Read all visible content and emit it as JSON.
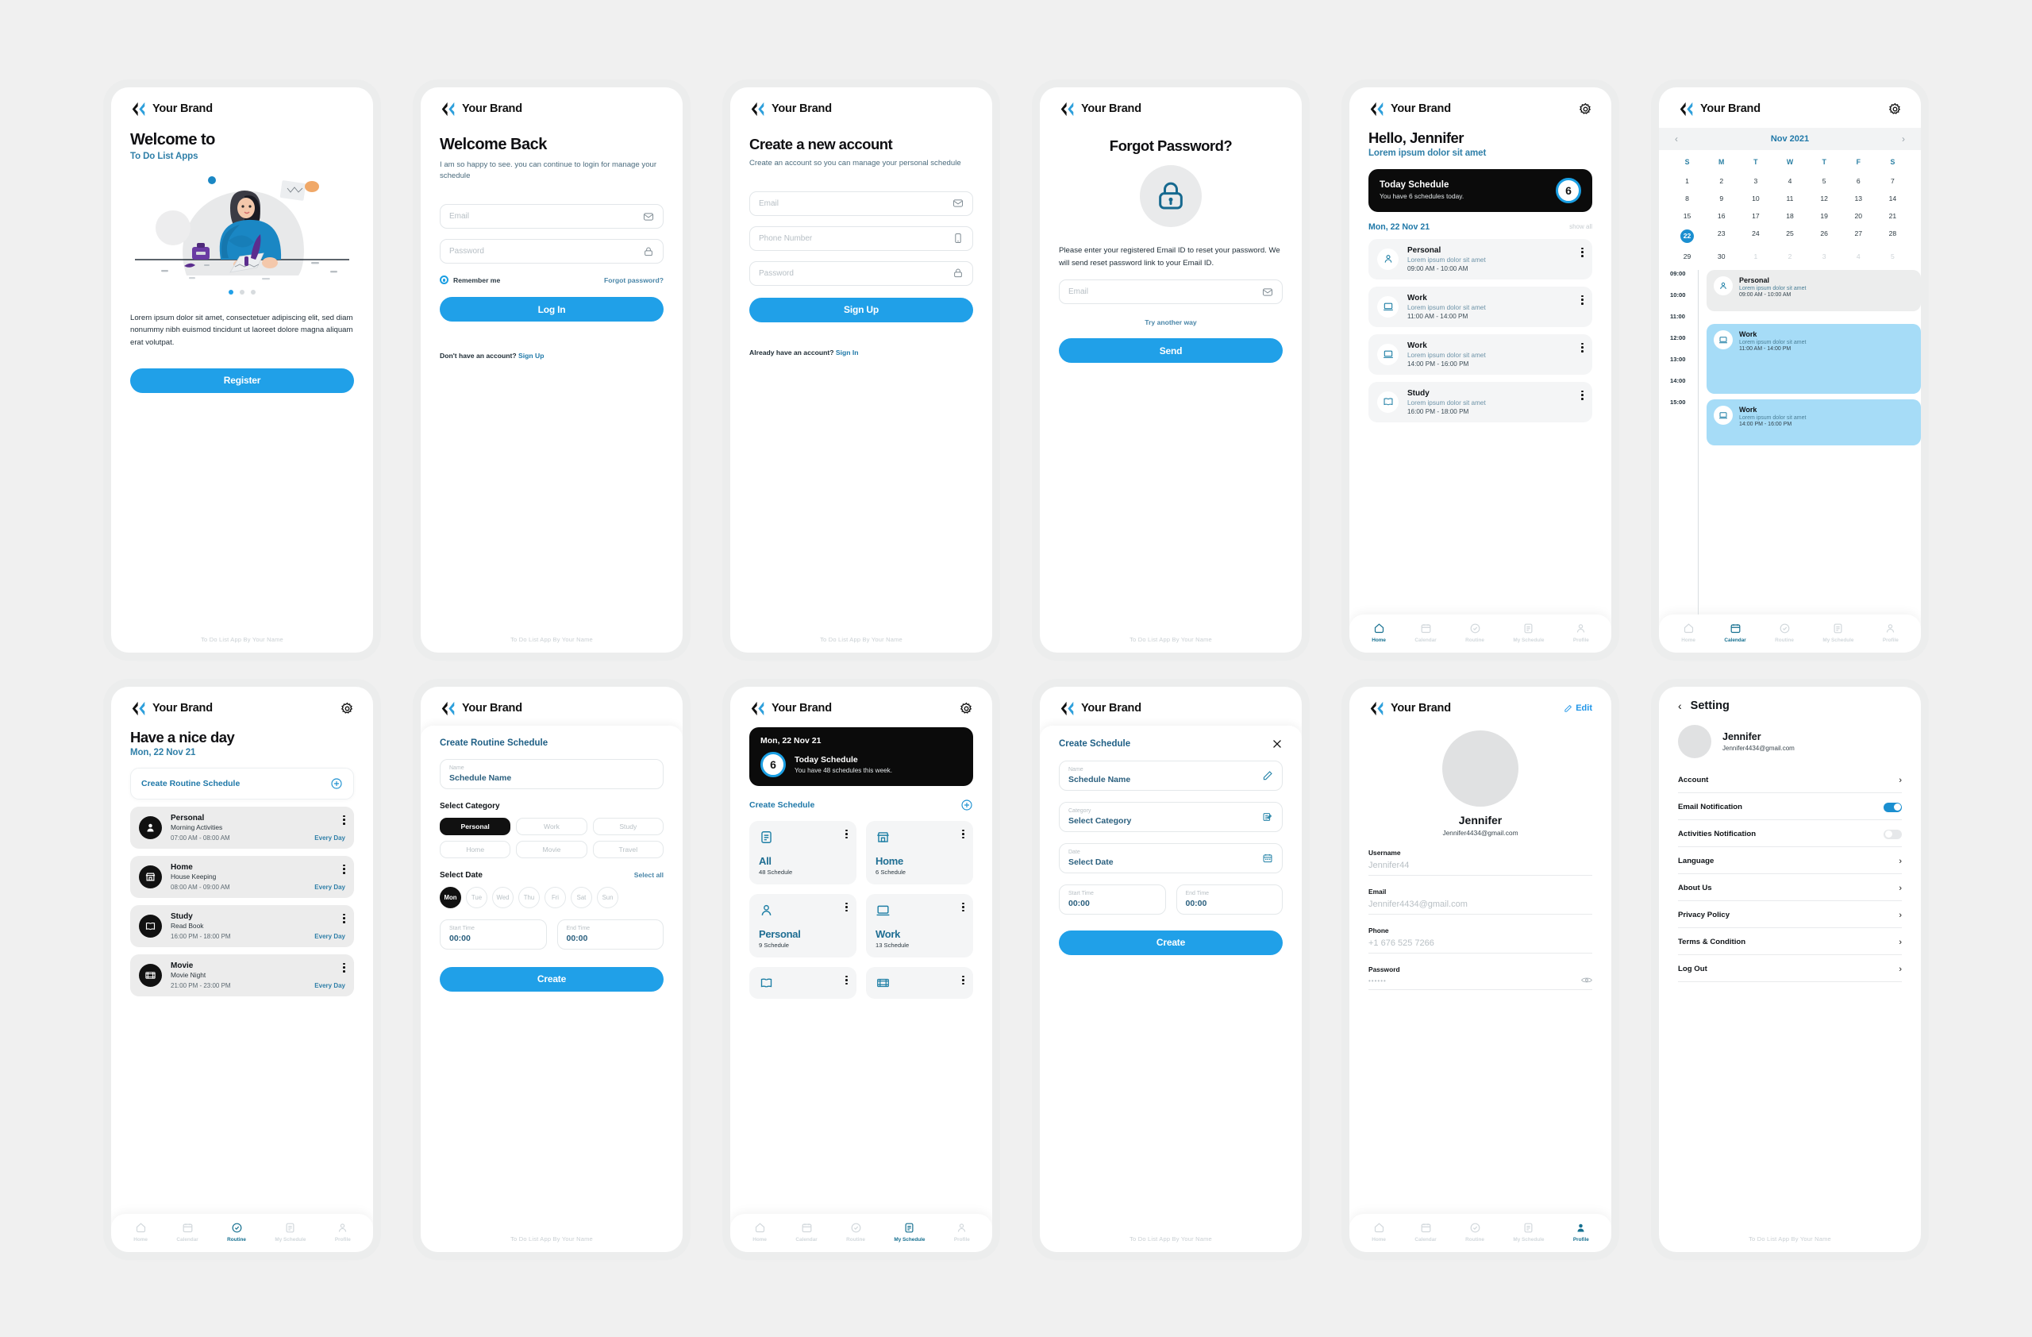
{
  "brand": {
    "name": "Your Brand",
    "footer": "To Do List App By Your Name"
  },
  "colors": {
    "accent": "#20a0e8",
    "dark": "#0b0b0b",
    "teal": "#1f78a8",
    "eventBlue": "#a6dcf7"
  },
  "nav": {
    "items": [
      {
        "label": "Home",
        "icon": "home-icon"
      },
      {
        "label": "Calendar",
        "icon": "calendar-icon"
      },
      {
        "label": "Routine",
        "icon": "check-circle-icon"
      },
      {
        "label": "My Schedule",
        "icon": "list-icon"
      },
      {
        "label": "Profile",
        "icon": "person-icon"
      }
    ]
  },
  "screen1": {
    "title": "Welcome to",
    "subtitle": "To Do List Apps",
    "paragraph": "Lorem ipsum dolor sit amet, consectetuer adipiscing elit, sed diam nonummy nibh euismod tincidunt ut laoreet dolore magna aliquam erat volutpat.",
    "button": "Register",
    "dots": 3,
    "active_dot": 0
  },
  "screen2": {
    "title": "Welcome Back",
    "lead": "I am so happy to see. you can continue to login for manage your schedule",
    "email_placeholder": "Email",
    "password_placeholder": "Password",
    "remember": "Remember me",
    "forgot": "Forgot password?",
    "button": "Log In",
    "account_text": "Don't have an account?",
    "account_link": "Sign Up"
  },
  "screen3": {
    "title": "Create a new account",
    "lead": "Create an account so you can manage your personal schedule",
    "email_placeholder": "Email",
    "phone_placeholder": "Phone Number",
    "password_placeholder": "Password",
    "button": "Sign Up",
    "account_text": "Already have an account?",
    "account_link": "Sign In"
  },
  "screen4": {
    "title": "Forgot Password?",
    "body": "Please enter your registered Email ID to reset your password. We will send reset password link to your Email ID.",
    "email_placeholder": "Email",
    "try_another": "Try another way",
    "button": "Send"
  },
  "screen5": {
    "greeting": "Hello, Jennifer",
    "subtitle": "Lorem ipsum dolor sit amet",
    "card_title": "Today Schedule",
    "card_sub": "You have 6 schedules today.",
    "count": "6",
    "date": "Mon, 22 Nov 21",
    "show_all": "show all",
    "items": [
      {
        "name": "Personal",
        "desc": "Lorem ipsum dolor sit amet",
        "time": "09:00 AM - 10:00 AM",
        "icon": "person-icon"
      },
      {
        "name": "Work",
        "desc": "Lorem ipsum dolor sit amet",
        "time": "11:00 AM - 14:00 PM",
        "icon": "laptop-icon"
      },
      {
        "name": "Work",
        "desc": "Lorem ipsum dolor sit amet",
        "time": "14:00 PM - 16:00 PM",
        "icon": "laptop-icon"
      },
      {
        "name": "Study",
        "desc": "Lorem ipsum dolor sit amet",
        "time": "16:00 PM - 18:00 PM",
        "icon": "book-icon"
      }
    ],
    "active_nav": "Home"
  },
  "screen6": {
    "month": "Nov 2021",
    "weekdays": [
      "S",
      "M",
      "T",
      "W",
      "T",
      "F",
      "S"
    ],
    "weeks": [
      [
        {
          "d": "1"
        },
        {
          "d": "2"
        },
        {
          "d": "3"
        },
        {
          "d": "4"
        },
        {
          "d": "5"
        },
        {
          "d": "6"
        },
        {
          "d": "7"
        }
      ],
      [
        {
          "d": "8"
        },
        {
          "d": "9"
        },
        {
          "d": "10"
        },
        {
          "d": "11"
        },
        {
          "d": "12"
        },
        {
          "d": "13"
        },
        {
          "d": "14"
        }
      ],
      [
        {
          "d": "15"
        },
        {
          "d": "16"
        },
        {
          "d": "17"
        },
        {
          "d": "18"
        },
        {
          "d": "19"
        },
        {
          "d": "20"
        },
        {
          "d": "21"
        }
      ],
      [
        {
          "d": "22",
          "sel": true
        },
        {
          "d": "23"
        },
        {
          "d": "24"
        },
        {
          "d": "25"
        },
        {
          "d": "26"
        },
        {
          "d": "27"
        },
        {
          "d": "28"
        }
      ],
      [
        {
          "d": "29"
        },
        {
          "d": "30"
        },
        {
          "d": "1",
          "mute": true
        },
        {
          "d": "2",
          "mute": true
        },
        {
          "d": "3",
          "mute": true
        },
        {
          "d": "4",
          "mute": true
        },
        {
          "d": "5",
          "mute": true
        }
      ]
    ],
    "hours": [
      "09:00",
      "10:00",
      "11:00",
      "12:00",
      "13:00",
      "14:00",
      "15:00"
    ],
    "events": [
      {
        "name": "Personal",
        "desc": "Lorem ipsum dolor sit amet",
        "time": "09:00 AM - 10:00 AM",
        "icon": "person-icon",
        "style": "grey",
        "height": 56
      },
      {
        "name": "Work",
        "desc": "Lorem ipsum dolor sit amet",
        "time": "11:00 AM - 14:00 PM",
        "icon": "laptop-icon",
        "style": "blue",
        "height": 92
      },
      {
        "name": "Work",
        "desc": "Lorem ipsum dolor sit amet",
        "time": "14:00 PM - 16:00 PM",
        "icon": "laptop-icon",
        "style": "blue",
        "height": 60
      }
    ],
    "active_nav": "Calendar"
  },
  "screen7": {
    "title": "Have a nice day",
    "date": "Mon, 22 Nov 21",
    "create_label": "Create Routine Schedule",
    "items": [
      {
        "name": "Personal",
        "sub": "Morning Activities",
        "time": "07:00 AM - 08:00 AM",
        "repeat": "Every Day",
        "icon": "person-icon"
      },
      {
        "name": "Home",
        "sub": "House Keeping",
        "time": "08:00 AM - 09:00 AM",
        "repeat": "Every Day",
        "icon": "store-icon"
      },
      {
        "name": "Study",
        "sub": "Read Book",
        "time": "16:00 PM - 18:00 PM",
        "repeat": "Every Day",
        "icon": "book-icon"
      },
      {
        "name": "Movie",
        "sub": "Movie Night",
        "time": "21:00 PM - 23:00 PM",
        "repeat": "Every Day",
        "icon": "film-icon"
      }
    ],
    "active_nav": "Routine"
  },
  "screen8": {
    "sheet_title": "Create Routine Schedule",
    "name_label": "Name",
    "name_value": "Schedule Name",
    "category_label": "Select Category",
    "categories": [
      "Personal",
      "Work",
      "Study",
      "Home",
      "Movie",
      "Travel"
    ],
    "category_selected": "Personal",
    "date_label": "Select Date",
    "select_all": "Select all",
    "days": [
      "Mon",
      "Tue",
      "Wed",
      "Thu",
      "Fri",
      "Sat",
      "Sun"
    ],
    "day_selected": "Mon",
    "start_label": "Start Time",
    "start_value": "00:00",
    "end_label": "End Time",
    "end_value": "00:00",
    "button": "Create"
  },
  "screen9": {
    "date": "Mon, 22 Nov 21",
    "count": "6",
    "card_title": "Today Schedule",
    "card_sub": "You have 48 schedules this week.",
    "create_label": "Create Schedule",
    "cards": [
      {
        "name": "All",
        "count": "48 Schedule",
        "icon": "list-icon"
      },
      {
        "name": "Home",
        "count": "6 Schedule",
        "icon": "store-icon"
      },
      {
        "name": "Personal",
        "count": "9 Schedule",
        "icon": "person-icon"
      },
      {
        "name": "Work",
        "count": "13 Schedule",
        "icon": "laptop-icon"
      },
      {
        "name": "",
        "count": "",
        "icon": "book-icon"
      },
      {
        "name": "",
        "count": "",
        "icon": "film-icon"
      }
    ],
    "active_nav": "My Schedule"
  },
  "screen10": {
    "sheet_title": "Create Schedule",
    "name_label": "Name",
    "name_value": "Schedule Name",
    "category_label": "Category",
    "category_value": "Select Category",
    "date_label": "Date",
    "date_value": "Select Date",
    "start_label": "Start Time",
    "start_value": "00:00",
    "end_label": "End Time",
    "end_value": "00:00",
    "button": "Create"
  },
  "screen11": {
    "edit": "Edit",
    "name": "Jennifer",
    "email": "Jennifer4434@gmail.com",
    "fields": [
      {
        "label": "Username",
        "value": "Jennifer44"
      },
      {
        "label": "Email",
        "value": "Jennifer4434@gmail.com"
      },
      {
        "label": "Phone",
        "value": "+1 676 525 7266"
      },
      {
        "label": "Password",
        "value": "••••••"
      }
    ],
    "active_nav": "Profile"
  },
  "screen12": {
    "title": "Setting",
    "name": "Jennifer",
    "email": "Jennifer4434@gmail.com",
    "rows": [
      {
        "label": "Account",
        "type": "chevron"
      },
      {
        "label": "Email Notification",
        "type": "toggle",
        "on": true
      },
      {
        "label": "Activities Notification",
        "type": "toggle",
        "on": false
      },
      {
        "label": "Language",
        "type": "chevron"
      },
      {
        "label": "About Us",
        "type": "chevron"
      },
      {
        "label": "Privacy Policy",
        "type": "chevron"
      },
      {
        "label": "Terms & Condition",
        "type": "chevron"
      },
      {
        "label": "Log Out",
        "type": "chevron"
      }
    ]
  }
}
